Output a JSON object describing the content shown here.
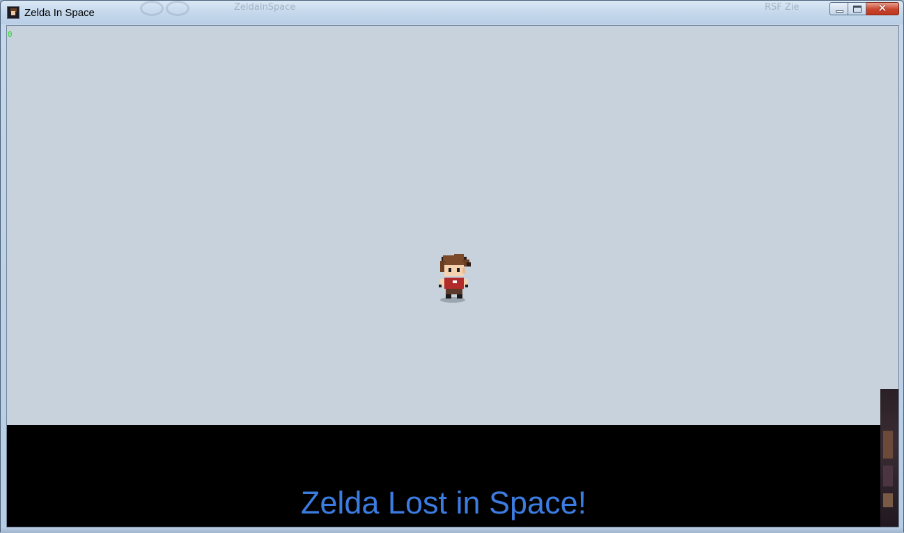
{
  "window": {
    "title": "Zelda In Space",
    "controls": {
      "minimize": "minimize",
      "maximize": "maximize",
      "close": "✕"
    }
  },
  "background_taskbar": {
    "text_1": "ZeldaInSpace",
    "text_2": "RSF Zie"
  },
  "game": {
    "fps_counter": "0",
    "caption": "Zelda Lost in Space!",
    "colors": {
      "sky": "#c7d2dc",
      "panel": "#000000",
      "caption": "#3c7be0",
      "fps": "#22dd22"
    }
  }
}
